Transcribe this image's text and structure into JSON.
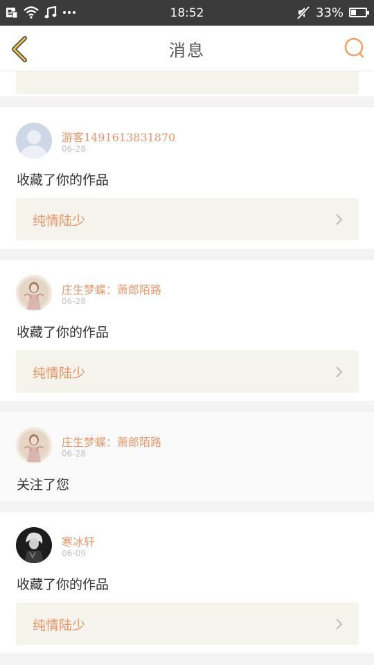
{
  "status_bar": {
    "time": "18:52",
    "battery": "33%",
    "battery_level": 0.33,
    "icons": [
      "notification-icon",
      "wifi-icon",
      "music-icon",
      "more-dots-icon",
      "mute-icon",
      "battery-icon"
    ]
  },
  "header": {
    "title": "消息",
    "back_icon": "chevron-left-icon",
    "search_icon": "search-icon"
  },
  "messages": [
    {
      "username": "游客1491613831870",
      "date": "06-28",
      "action": "收藏了你的作品",
      "work_title": "纯情陆少",
      "avatar": "default-avatar"
    },
    {
      "username": "庄生梦蝶：萧郎陌路",
      "date": "06-28",
      "action": "收藏了你的作品",
      "work_title": "纯情陆少",
      "avatar": "illustrated-avatar"
    },
    {
      "username": "庄生梦蝶：萧郎陌路",
      "date": "06-28",
      "action": "关注了您",
      "avatar": "illustrated-avatar"
    },
    {
      "username": "寒冰轩",
      "date": "06-09",
      "action": "收藏了你的作品",
      "work_title": "纯情陆少",
      "avatar": "dark-portrait-avatar"
    }
  ],
  "colors": {
    "accent": "#ee9466",
    "back_icon": "#d9a520",
    "work_card_bg": "#f5f4ec",
    "status_bar_bg": "#3b3b3b"
  }
}
